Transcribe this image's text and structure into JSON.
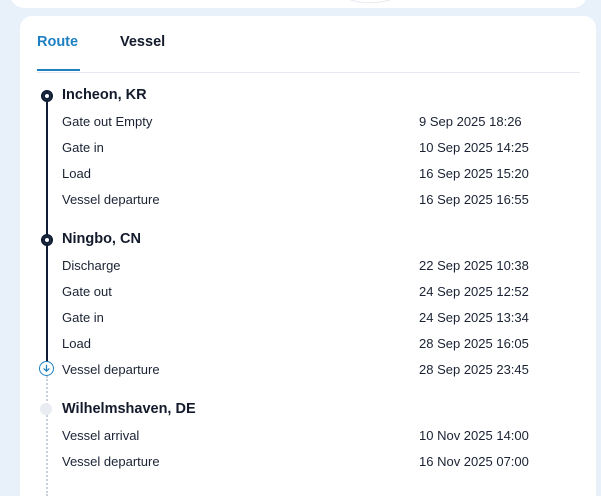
{
  "tabs": [
    {
      "label": "Route",
      "active": true
    },
    {
      "label": "Vessel",
      "active": false
    }
  ],
  "ports": [
    {
      "name": "Incheon, KR",
      "status": "completed",
      "events": [
        {
          "label": "Gate out Empty",
          "date": "9 Sep 2025 18:26"
        },
        {
          "label": "Gate in",
          "date": "10 Sep 2025 14:25"
        },
        {
          "label": "Load",
          "date": "16 Sep 2025 15:20"
        },
        {
          "label": "Vessel departure",
          "date": "16 Sep 2025 16:55"
        }
      ]
    },
    {
      "name": "Ningbo, CN",
      "status": "completed",
      "events": [
        {
          "label": "Discharge",
          "date": "22 Sep 2025 10:38"
        },
        {
          "label": "Gate out",
          "date": "24 Sep 2025 12:52"
        },
        {
          "label": "Gate in",
          "date": "24 Sep 2025 13:34"
        },
        {
          "label": "Load",
          "date": "28 Sep 2025 16:05"
        },
        {
          "label": "Vessel departure",
          "date": "28 Sep 2025 23:45"
        }
      ]
    },
    {
      "name": "Wilhelmshaven, DE",
      "status": "upcoming",
      "events": [
        {
          "label": "Vessel arrival",
          "date": "10 Nov 2025 14:00"
        },
        {
          "label": "Vessel departure",
          "date": "16 Nov 2025 07:00"
        }
      ]
    }
  ],
  "colors": {
    "accent": "#1e80c2",
    "timeline_done": "#0f1a33",
    "timeline_future": "#c9d0da",
    "background": "#e8f1fa"
  },
  "icons": {
    "current_event": "chevron-down-circle-icon",
    "port_done": "port-node-icon",
    "port_future": "future-port-node-icon"
  }
}
